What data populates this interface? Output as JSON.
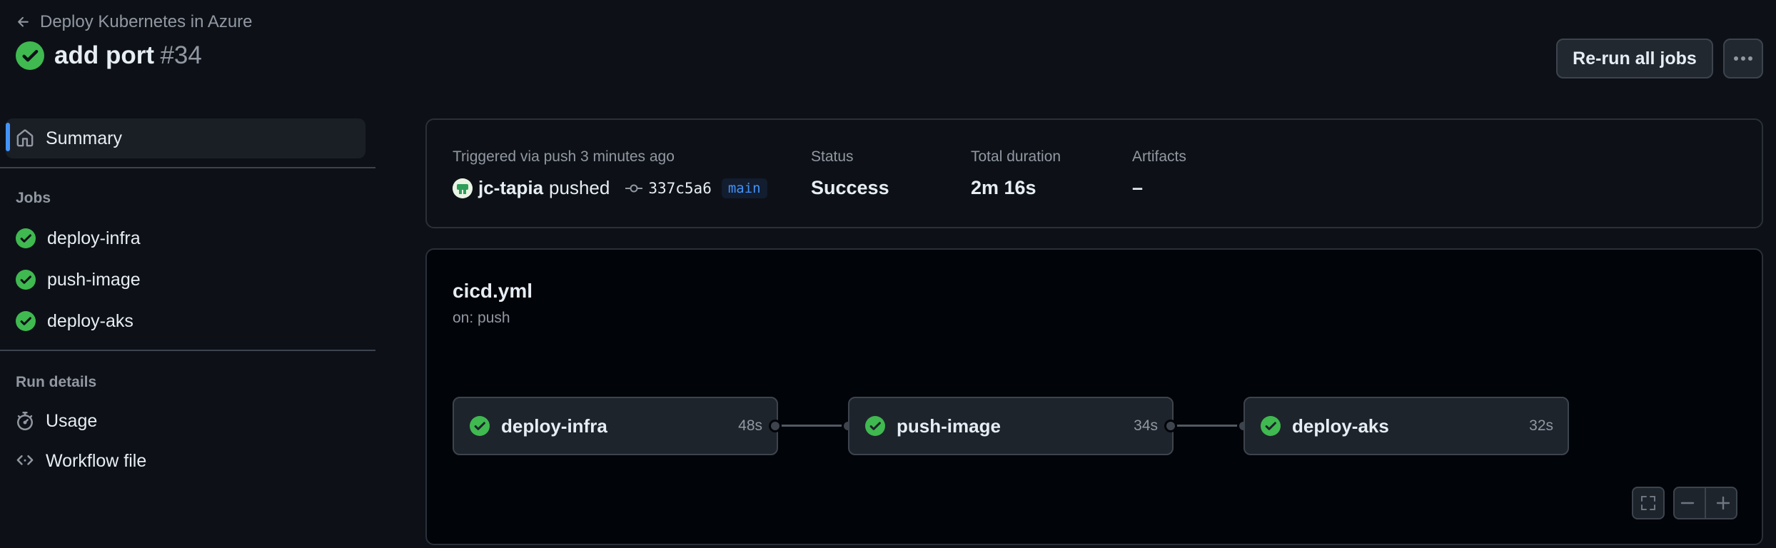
{
  "header": {
    "back_label": "Deploy Kubernetes in Azure",
    "run_title": "add port",
    "run_number": "#34",
    "rerun_label": "Re-run all jobs"
  },
  "sidebar": {
    "summary_label": "Summary",
    "jobs_heading": "Jobs",
    "jobs": [
      {
        "label": "deploy-infra",
        "status": "success"
      },
      {
        "label": "push-image",
        "status": "success"
      },
      {
        "label": "deploy-aks",
        "status": "success"
      }
    ],
    "run_details_heading": "Run details",
    "usage_label": "Usage",
    "workflow_file_label": "Workflow file"
  },
  "summary": {
    "trigger_text": "Triggered via push 3 minutes ago",
    "actor": "jc-tapia",
    "action": "pushed",
    "commit_sha": "337c5a6",
    "branch": "main",
    "status_label": "Status",
    "status_value": "Success",
    "duration_label": "Total duration",
    "duration_value": "2m 16s",
    "artifacts_label": "Artifacts",
    "artifacts_value": "–"
  },
  "workflow": {
    "name": "cicd.yml",
    "trigger": "on: push",
    "jobs": [
      {
        "name": "deploy-infra",
        "duration": "48s",
        "status": "success"
      },
      {
        "name": "push-image",
        "duration": "34s",
        "status": "success"
      },
      {
        "name": "deploy-aks",
        "duration": "32s",
        "status": "success"
      }
    ]
  },
  "colors": {
    "background": "#0d1117",
    "success": "#3fb950",
    "accent": "#4493f8",
    "muted_text": "#9198a1"
  }
}
